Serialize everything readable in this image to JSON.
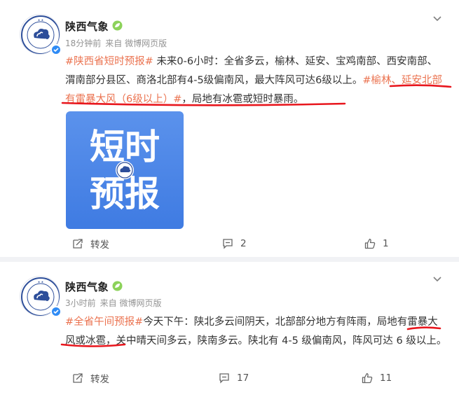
{
  "posts": [
    {
      "author": "陕西气象",
      "time": "18分钟前",
      "source": "来自 微博网页版",
      "text": {
        "tag1": "#陕西省短时预报#",
        "body1": " 未来0-6小时：全省多云，榆林、延安、宝鸡南部、西安南部、渭南部分县区、商洛北部有4-5级偏南风，最大阵风可达6级以上。",
        "tag2": "#榆林、延安北部有雷暴大风（6级以上）#",
        "body2": "，局地有冰雹或短时暴雨。"
      },
      "image": {
        "line1": "短时",
        "line2": "预报"
      },
      "actions": {
        "repost": "转发",
        "comments": "2",
        "likes": "1"
      }
    },
    {
      "author": "陕西气象",
      "time": "3小时前",
      "source": "来自 微博网页版",
      "text": {
        "tag1": "#全省午间预报#",
        "body1": "今天下午：陕北多云间阴天，北部部分地方有阵雨，局地有雷暴大风或冰雹，关中晴天间多云，陕南多云。陕北有 4-5 级偏南风，阵风可达 6 级以上。"
      },
      "actions": {
        "repost": "转发",
        "comments": "17",
        "likes": "11"
      }
    }
  ],
  "colors": {
    "tag": "#eb7350",
    "annotation": "#e8161d",
    "verified": "#2f8bf5",
    "thumb_bg": "#4a86e8"
  }
}
